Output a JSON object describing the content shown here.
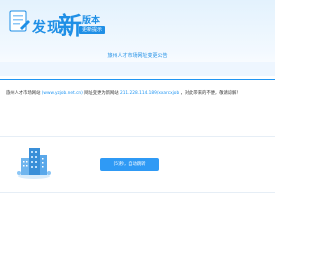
{
  "banner": {
    "title_discover": "发现",
    "title_new": "新",
    "title_version": "版本",
    "badge": "更新提示",
    "notice_title": "旅州人才市场网址变更公告"
  },
  "notice": {
    "prefix": "旅州人才市场网站",
    "old_url": "(www.yzjob.net.cn)",
    "middle": "网址变更为新网站",
    "new_url": "211.228.114.189/xxarcxjob",
    "suffix": "，对此带来的不便，敬请谅解！"
  },
  "countdown": {
    "label": "[5]秒，自动跳转"
  },
  "colors": {
    "accent": "#1f8fe6",
    "button": "#2f9af5",
    "divider": "#2196f3"
  }
}
